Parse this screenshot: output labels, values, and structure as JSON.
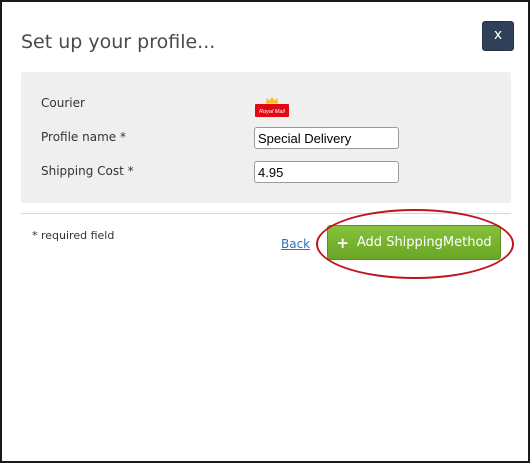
{
  "dialog": {
    "title": "Set up your profile...",
    "close_label": "x"
  },
  "form": {
    "courier_label": "Courier",
    "courier_logo": {
      "icon": "royal-mail-logo",
      "text": "Royal Mail",
      "colors": {
        "background": "#e30613",
        "crown": "#f6c21c",
        "text": "#ffffff"
      }
    },
    "profile_name_label": "Profile name *",
    "profile_name_value": "Special Delivery",
    "shipping_cost_label": "Shipping Cost *",
    "shipping_cost_value": "4.95"
  },
  "footer": {
    "required_note": "* required field",
    "back_label": "Back",
    "add_button_label": "Add ShippingMethod",
    "add_button_icon": "plus-icon"
  },
  "colors": {
    "close_button": "#2f4058",
    "add_button": "#7ab534",
    "link": "#3072b8",
    "highlight": "#c0141e",
    "panel": "#efefef"
  }
}
